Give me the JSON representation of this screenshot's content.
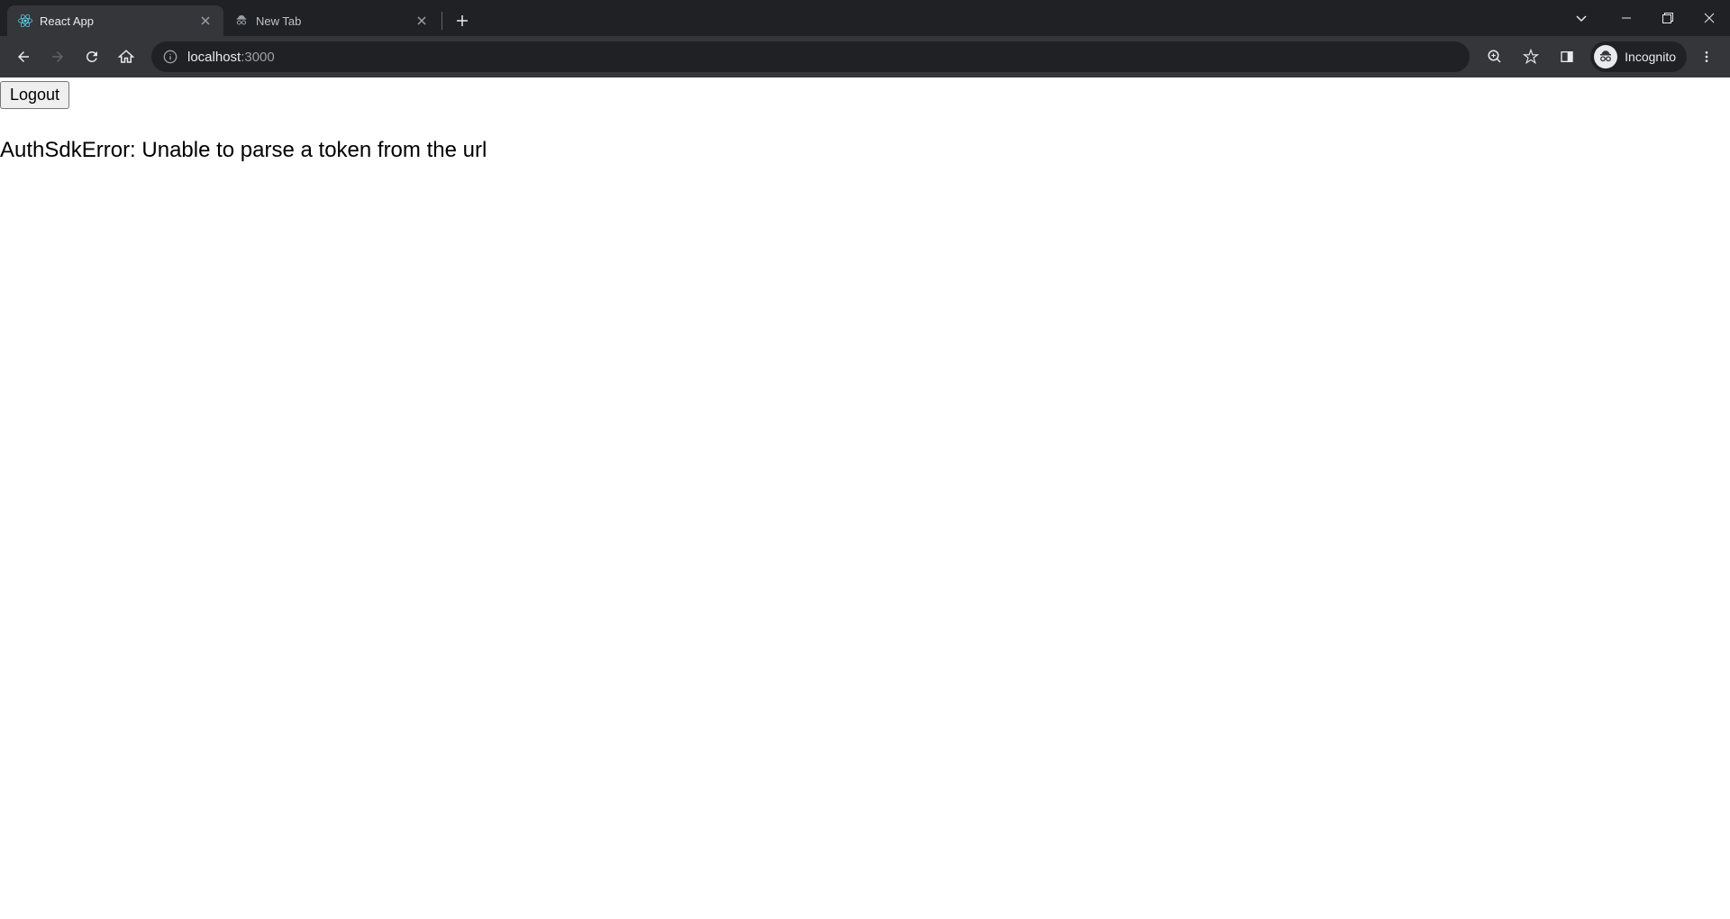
{
  "browser": {
    "tabs": [
      {
        "title": "React App",
        "active": true,
        "favicon": "react-logo"
      },
      {
        "title": "New Tab",
        "active": false,
        "favicon": "incognito"
      }
    ],
    "url_host": "localhost",
    "url_port": ":3000",
    "incognito_label": "Incognito"
  },
  "page": {
    "logout_label": "Logout",
    "error_message": "AuthSdkError: Unable to parse a token from the url"
  }
}
